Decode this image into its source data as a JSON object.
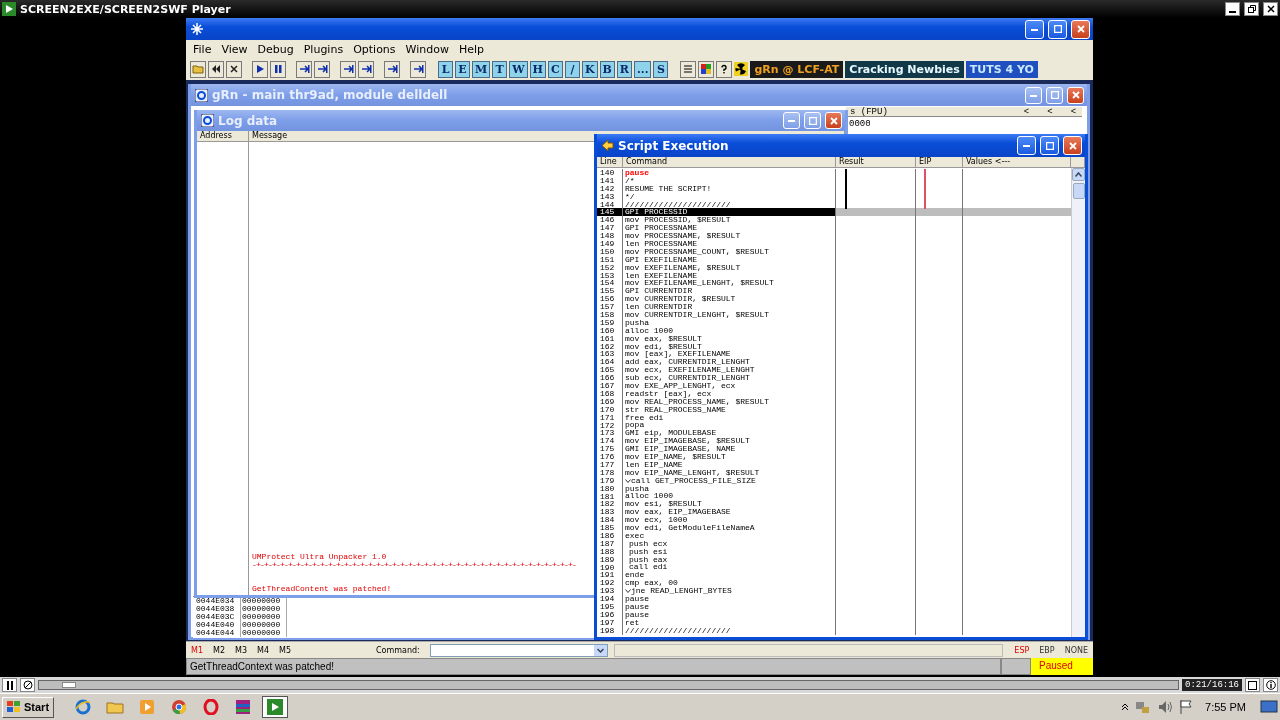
{
  "player": {
    "title": "SCREEN2EXE/SCREEN2SWF Player",
    "time": "0:21/16:16",
    "level": 0.02
  },
  "app": {
    "menu": [
      "File",
      "View",
      "Debug",
      "Plugins",
      "Options",
      "Window",
      "Help"
    ],
    "tool_letters": [
      "L",
      "E",
      "M",
      "T",
      "W",
      "H",
      "C",
      "/",
      "K",
      "B",
      "R",
      "...",
      "S"
    ],
    "banners": [
      "gRn @ LCF-AT",
      "Cracking Newbies",
      "TUTS 4 YO"
    ]
  },
  "cpu_window": {
    "title": "gRn - main thr9ad, module delldell",
    "fpu_header": "s (FPU)",
    "fpu_value": "0000",
    "arrows": [
      "<",
      "<",
      "<"
    ],
    "dump": [
      {
        "address": "0044E034",
        "value": "00000000"
      },
      {
        "address": "0044E038",
        "value": "00000000"
      },
      {
        "address": "0044E03C",
        "value": "00000000"
      },
      {
        "address": "0044E040",
        "value": "00000000"
      },
      {
        "address": "0044E044",
        "value": "00000000"
      }
    ]
  },
  "log_window": {
    "title": "Log data",
    "columns": [
      "Address",
      "Message"
    ],
    "messages": [
      {
        "kind": "text",
        "text": "UMProtect Ultra Unpacker 1.0"
      },
      {
        "kind": "rule",
        "text": "-+-+-+-+-+-+-+-+-+-+-+-+-+-+-+-+-+-+-+-+-+-+-+-+-+-+-+-+-+-+-+-+-+-+-+-+-+-+-+-+-"
      },
      {
        "kind": "text",
        "text": "GetThreadContent was patched!"
      }
    ]
  },
  "script_window": {
    "title": "Script Execution",
    "columns": [
      "Line",
      "Command",
      "Result",
      "EIP",
      "Values <---"
    ],
    "lines": [
      {
        "n": "140",
        "cmd": "pause",
        "selected": false,
        "fold": false,
        "color": "#ff0000"
      },
      {
        "n": "141",
        "cmd": "/*",
        "selected": false,
        "fold": false
      },
      {
        "n": "142",
        "cmd": "RESUME THE SCRIPT!",
        "selected": false,
        "fold": false
      },
      {
        "n": "143",
        "cmd": "*/",
        "selected": false,
        "fold": false
      },
      {
        "n": "144",
        "cmd": "//////////////////////",
        "selected": false,
        "fold": false
      },
      {
        "n": "145",
        "cmd": "GPI PROCESSID",
        "selected": true,
        "fold": false
      },
      {
        "n": "146",
        "cmd": "mov PROCESSID, $RESULT",
        "selected": false,
        "fold": false
      },
      {
        "n": "147",
        "cmd": "GPI PROCESSNAME",
        "selected": false,
        "fold": false
      },
      {
        "n": "148",
        "cmd": "mov PROCESSNAME, $RESULT",
        "selected": false,
        "fold": false
      },
      {
        "n": "149",
        "cmd": "len PROCESSNAME",
        "selected": false,
        "fold": false
      },
      {
        "n": "150",
        "cmd": "mov PROCESSNAME_COUNT, $RESULT",
        "selected": false,
        "fold": false
      },
      {
        "n": "151",
        "cmd": "GPI EXEFILENAME",
        "selected": false,
        "fold": false
      },
      {
        "n": "152",
        "cmd": "mov EXEFILENAME, $RESULT",
        "selected": false,
        "fold": false
      },
      {
        "n": "153",
        "cmd": "len EXEFILENAME",
        "selected": false,
        "fold": false
      },
      {
        "n": "154",
        "cmd": "mov EXEFILENAME_LENGHT, $RESULT",
        "selected": false,
        "fold": false
      },
      {
        "n": "155",
        "cmd": "GPI CURRENTDIR",
        "selected": false,
        "fold": false
      },
      {
        "n": "156",
        "cmd": "mov CURRENTDIR, $RESULT",
        "selected": false,
        "fold": false
      },
      {
        "n": "157",
        "cmd": "len CURRENTDIR",
        "selected": false,
        "fold": false
      },
      {
        "n": "158",
        "cmd": "mov CURRENTDIR_LENGHT, $RESULT",
        "selected": false,
        "fold": false
      },
      {
        "n": "159",
        "cmd": "pusha",
        "selected": false,
        "fold": false
      },
      {
        "n": "160",
        "cmd": "alloc 1000",
        "selected": false,
        "fold": false
      },
      {
        "n": "161",
        "cmd": "mov eax, $RESULT",
        "selected": false,
        "fold": false
      },
      {
        "n": "162",
        "cmd": "mov edi, $RESULT",
        "selected": false,
        "fold": false
      },
      {
        "n": "163",
        "cmd": "mov [eax], EXEFILENAME",
        "selected": false,
        "fold": false
      },
      {
        "n": "164",
        "cmd": "add eax, CURRENTDIR_LENGHT",
        "selected": false,
        "fold": false
      },
      {
        "n": "165",
        "cmd": "mov ecx, EXEFILENAME_LENGHT",
        "selected": false,
        "fold": false
      },
      {
        "n": "166",
        "cmd": "sub ecx, CURRENTDIR_LENGHT",
        "selected": false,
        "fold": false
      },
      {
        "n": "167",
        "cmd": "mov EXE_APP_LENGHT, ecx",
        "selected": false,
        "fold": false
      },
      {
        "n": "168",
        "cmd": "readstr [eax], ecx",
        "selected": false,
        "fold": false
      },
      {
        "n": "169",
        "cmd": "mov REAL_PROCESS_NAME, $RESULT",
        "selected": false,
        "fold": false
      },
      {
        "n": "170",
        "cmd": "str REAL_PROCESS_NAME",
        "selected": false,
        "fold": false
      },
      {
        "n": "171",
        "cmd": "free edi",
        "selected": false,
        "fold": false
      },
      {
        "n": "172",
        "cmd": "popa",
        "selected": false,
        "fold": false
      },
      {
        "n": "173",
        "cmd": "GMI eip, MODULEBASE",
        "selected": false,
        "fold": false
      },
      {
        "n": "174",
        "cmd": "mov EIP_IMAGEBASE, $RESULT",
        "selected": false,
        "fold": false
      },
      {
        "n": "175",
        "cmd": "GMI EIP_IMAGEBASE, NAME",
        "selected": false,
        "fold": false
      },
      {
        "n": "176",
        "cmd": "mov EIP_NAME, $RESULT",
        "selected": false,
        "fold": false
      },
      {
        "n": "177",
        "cmd": "len EIP_NAME",
        "selected": false,
        "fold": false
      },
      {
        "n": "178",
        "cmd": "mov EIP_NAME_LENGHT, $RESULT",
        "selected": false,
        "fold": false
      },
      {
        "n": "179",
        "cmd": "call GET_PROCESS_FILE_SIZE",
        "selected": false,
        "fold": true
      },
      {
        "n": "180",
        "cmd": "pusha",
        "selected": false,
        "fold": false
      },
      {
        "n": "181",
        "cmd": "alloc 1000",
        "selected": false,
        "fold": false
      },
      {
        "n": "182",
        "cmd": "mov esi, $RESULT",
        "selected": false,
        "fold": false
      },
      {
        "n": "183",
        "cmd": "mov eax, EIP_IMAGEBASE",
        "selected": false,
        "fold": false
      },
      {
        "n": "184",
        "cmd": "mov ecx, 1000",
        "selected": false,
        "fold": false
      },
      {
        "n": "185",
        "cmd": "mov edi, GetModuleFileNameA",
        "selected": false,
        "fold": false
      },
      {
        "n": "186",
        "cmd": "exec",
        "selected": false,
        "fold": false,
        "children": [
          {
            "n": "187",
            "cmd": "push ecx",
            "selected": false,
            "fold": false
          },
          {
            "n": "188",
            "cmd": "push esi",
            "selected": false,
            "fold": false
          },
          {
            "n": "189",
            "cmd": "push eax",
            "selected": false,
            "fold": false
          },
          {
            "n": "190",
            "cmd": "call edi",
            "selected": false,
            "fold": false
          }
        ]
      },
      {
        "n": "191",
        "cmd": "ende",
        "selected": false,
        "fold": false
      },
      {
        "n": "192",
        "cmd": "cmp eax, 00",
        "selected": false,
        "fold": false
      },
      {
        "n": "193",
        "cmd": "jne READ_LENGHT_BYTES",
        "selected": false,
        "fold": true
      },
      {
        "n": "194",
        "cmd": "pause",
        "selected": false,
        "fold": false
      },
      {
        "n": "195",
        "cmd": "pause",
        "selected": false,
        "fold": false
      },
      {
        "n": "196",
        "cmd": "pause",
        "selected": false,
        "fold": false
      },
      {
        "n": "197",
        "cmd": "ret",
        "selected": false,
        "fold": false
      },
      {
        "n": "198",
        "cmd": "//////////////////////",
        "selected": false,
        "fold": false
      }
    ]
  },
  "command_bar": {
    "marks": [
      {
        "label": "M1",
        "selected": true
      },
      {
        "label": "M2",
        "selected": false
      },
      {
        "label": "M3",
        "selected": false
      },
      {
        "label": "M4",
        "selected": false
      },
      {
        "label": "M5",
        "selected": false
      }
    ],
    "command_label": "Command:",
    "registers": [
      {
        "label": "ESP",
        "selected": true
      },
      {
        "label": "EBP",
        "selected": false
      },
      {
        "label": "NONE",
        "selected": false
      }
    ]
  },
  "status_bar": {
    "message": "GetThreadContext was patched!",
    "state": "Paused"
  },
  "taskbar": {
    "start": "Start",
    "clock": "7:55 PM"
  }
}
